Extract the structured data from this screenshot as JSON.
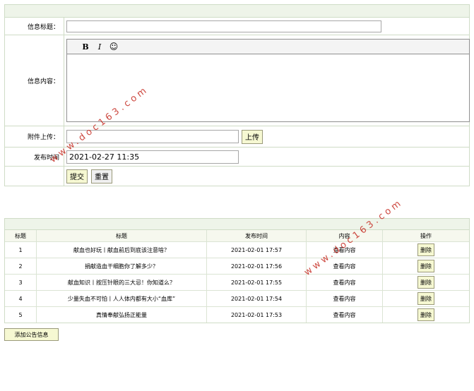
{
  "form": {
    "title_label": "信息标题：",
    "title_value": "",
    "content_label": "信息内容：",
    "editor_tools": [
      "B",
      "I",
      "☺"
    ],
    "attachment_label": "附件上传：",
    "attachment_value": "",
    "upload_label": "上传",
    "time_label": "发布时间",
    "time_value": "2021-02-27 11:35",
    "submit_label": "提交",
    "reset_label": "重置"
  },
  "table": {
    "headers": [
      "标题",
      "标题",
      "发布时间",
      "内容",
      "操作"
    ],
    "rows": [
      {
        "id": "1",
        "title": "献血也好玩丨献血前后到底该注意啥？",
        "time": "2021-02-01 17:57",
        "view": "查看内容",
        "action": "删除"
      },
      {
        "id": "2",
        "title": "捐献造血干细胞你了解多少？",
        "time": "2021-02-01 17:56",
        "view": "查看内容",
        "action": "删除"
      },
      {
        "id": "3",
        "title": "献血知识丨按压针眼的三大忌！你知道么？",
        "time": "2021-02-01 17:55",
        "view": "查看内容",
        "action": "删除"
      },
      {
        "id": "4",
        "title": "少量失血不可怕丨人人体内都有大小“血库”",
        "time": "2021-02-01 17:54",
        "view": "查看内容",
        "action": "删除"
      },
      {
        "id": "5",
        "title": "真情奉献弘扬正能量",
        "time": "2021-02-01 17:53",
        "view": "查看内容",
        "action": "删除"
      }
    ]
  },
  "add_label": "添加公告信息",
  "watermark": "www.doc163.com",
  "colors": {
    "border": "#cfdcc6",
    "header_bg": "#eef4e9",
    "button_bg": "#f6f8d2",
    "watermark": "#c8352c"
  }
}
